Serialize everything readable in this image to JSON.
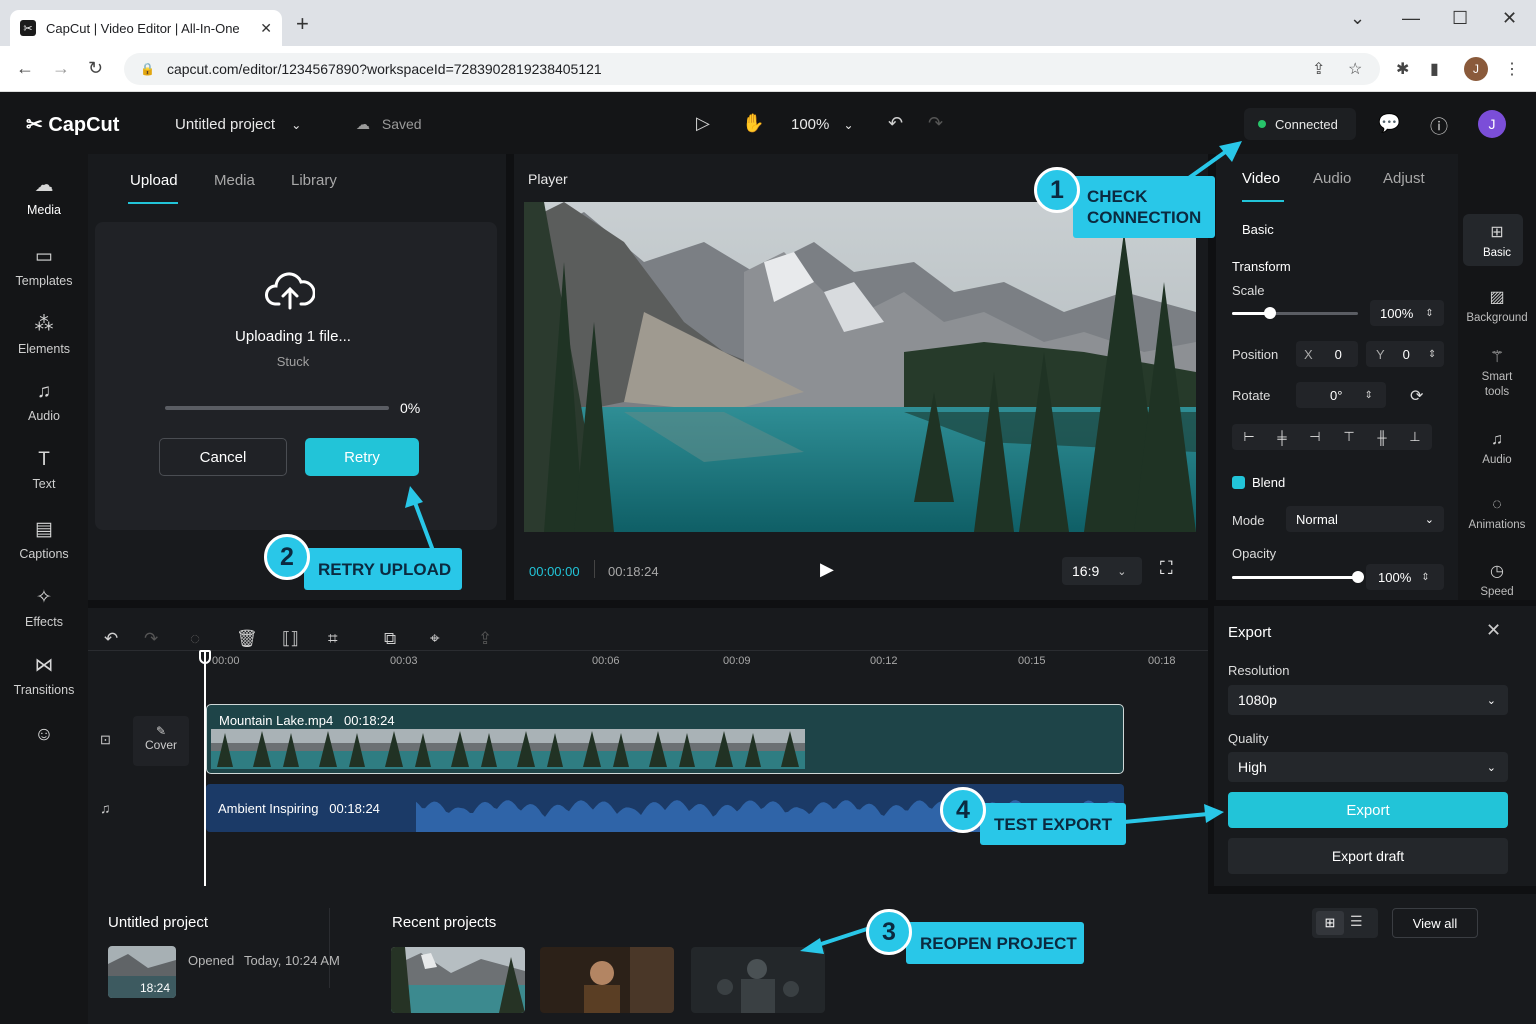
{
  "browser": {
    "tab_title": "CapCut | Video Editor | All-In-One",
    "url": "capcut.com/editor/1234567890?workspaceId=7283902819238405121",
    "profile_initial": "J"
  },
  "topbar": {
    "logo": "CapCut",
    "project_name": "Untitled project",
    "save_status": "Saved",
    "zoom": "100%",
    "connection": "Connected",
    "avatar_initial": "J"
  },
  "rail": {
    "items": [
      {
        "label": "Media",
        "icon": "cloud-upload-icon"
      },
      {
        "label": "Templates",
        "icon": "templates-icon"
      },
      {
        "label": "Elements",
        "icon": "elements-icon"
      },
      {
        "label": "Audio",
        "icon": "music-note-icon"
      },
      {
        "label": "Text",
        "icon": "text-icon"
      },
      {
        "label": "Captions",
        "icon": "captions-icon"
      },
      {
        "label": "Effects",
        "icon": "sparkle-icon"
      },
      {
        "label": "Transitions",
        "icon": "transitions-icon"
      }
    ]
  },
  "upload_panel": {
    "tabs": [
      "Upload",
      "Media",
      "Library"
    ],
    "status": "Uploading 1 file...",
    "substatus": "Stuck",
    "progress_percent": "0%",
    "progress_value": 0,
    "cancel_label": "Cancel",
    "retry_label": "Retry"
  },
  "player": {
    "title": "Player",
    "current_time": "00:00:00",
    "duration": "00:18:24",
    "ratio": "16:9"
  },
  "properties": {
    "tabs": [
      "Video",
      "Audio",
      "Adjust"
    ],
    "section": "Basic",
    "transform_label": "Transform",
    "scale_label": "Scale",
    "scale_value": "100%",
    "scale_fraction": 0.3,
    "position_label": "Position",
    "pos_x_label": "X",
    "pos_x": "0",
    "pos_y_label": "Y",
    "pos_y": "0",
    "rotate_label": "Rotate",
    "rotate_value": "0°",
    "blend_label": "Blend",
    "mode_label": "Mode",
    "mode_value": "Normal",
    "opacity_label": "Opacity",
    "opacity_value": "100%",
    "opacity_fraction": 1.0,
    "nav": [
      {
        "label": "Basic",
        "icon": "basic-icon"
      },
      {
        "label": "Background",
        "icon": "background-icon"
      },
      {
        "label": "Smart tools",
        "icon": "magic-wand-icon"
      },
      {
        "label": "Audio",
        "icon": "music-note-icon"
      },
      {
        "label": "Animations",
        "icon": "animations-icon"
      },
      {
        "label": "Speed",
        "icon": "speed-icon"
      }
    ]
  },
  "timeline": {
    "ticks": [
      "00:00",
      "00:03",
      "00:06",
      "00:09",
      "00:12",
      "00:15",
      "00:18"
    ],
    "cover_label": "Cover",
    "video_clip": {
      "name": "Mountain Lake.mp4",
      "duration": "00:18:24"
    },
    "audio_clip": {
      "name": "Ambient Inspiring",
      "duration": "00:18:24"
    }
  },
  "export": {
    "title": "Export",
    "resolution_label": "Resolution",
    "resolution_value": "1080p",
    "quality_label": "Quality",
    "quality_value": "High",
    "export_label": "Export",
    "draft_label": "Export draft"
  },
  "bottom": {
    "project_title": "Untitled project",
    "opened_label": "Opened",
    "opened_time": "Today, 10:24 AM",
    "thumb_duration": "18:24",
    "recent_title": "Recent projects",
    "view_all": "View all"
  },
  "callouts": [
    {
      "number": "1",
      "text": "CHECK CONNECTION"
    },
    {
      "number": "2",
      "text": "RETRY UPLOAD"
    },
    {
      "number": "3",
      "text": "REOPEN PROJECT"
    },
    {
      "number": "4",
      "text": "TEST EXPORT"
    }
  ],
  "colors": {
    "accent": "#22c4d8",
    "callout": "#29c7e8",
    "connected_dot": "#27c46a",
    "avatar": "#7b4ed8"
  }
}
